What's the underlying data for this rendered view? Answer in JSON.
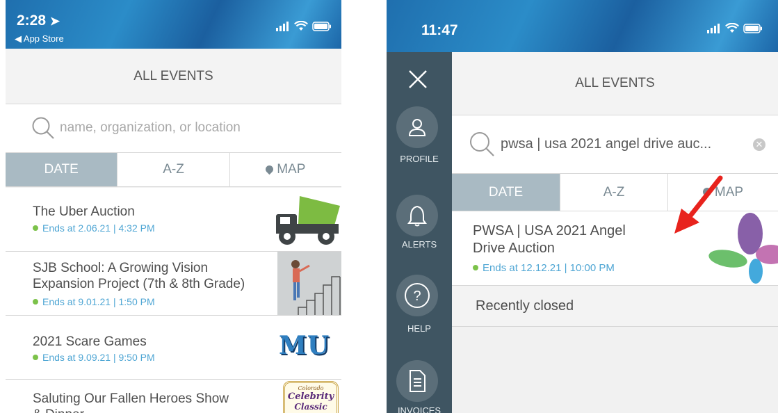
{
  "left": {
    "status": {
      "time": "2:28",
      "back_label": "◀ App Store"
    },
    "header": {
      "title": "ALL EVENTS"
    },
    "search": {
      "placeholder": "name, organization, or location"
    },
    "tabs": {
      "date": "DATE",
      "az": "A-Z",
      "map": "MAP"
    },
    "events": [
      {
        "title": "The Uber Auction",
        "ends": "Ends at 2.06.21 | 4:32 PM"
      },
      {
        "title_line1": "SJB School: A Growing Vision",
        "title_line2": "Expansion Project (7th & 8th Grade)",
        "ends": "Ends at 9.01.21 | 1:50 PM"
      },
      {
        "title": "2021 Scare Games",
        "ends": "Ends at 9.09.21 | 9:50 PM",
        "thumb_text": "MU"
      },
      {
        "title_line1": "Saluting Our Fallen Heroes Show",
        "title_line2": "& Dinner",
        "thumb_text_1": "Colorado",
        "thumb_text_2": "Celebrity",
        "thumb_text_3": "Classic"
      }
    ]
  },
  "right": {
    "status": {
      "time": "11:47"
    },
    "sidenav": {
      "profile": "PROFILE",
      "alerts": "ALERTS",
      "help": "HELP",
      "invoices": "INVOICES"
    },
    "header": {
      "title": "ALL EVENTS"
    },
    "search": {
      "value": "pwsa | usa 2021 angel drive auc..."
    },
    "tabs": {
      "date": "DATE",
      "az": "A-Z",
      "map": "MAP"
    },
    "event": {
      "title_line1": "PWSA | USA 2021 Angel",
      "title_line2": "Drive Auction",
      "ends": "Ends at 12.12.21 | 10:00 PM"
    },
    "recently_closed": "Recently closed"
  },
  "colors": {
    "active_tab": "#a9bac3",
    "link_blue": "#4fa6d4",
    "dot_green": "#7cc24a",
    "sidenav": "#3f5562",
    "annotation_arrow": "#e8231d"
  }
}
